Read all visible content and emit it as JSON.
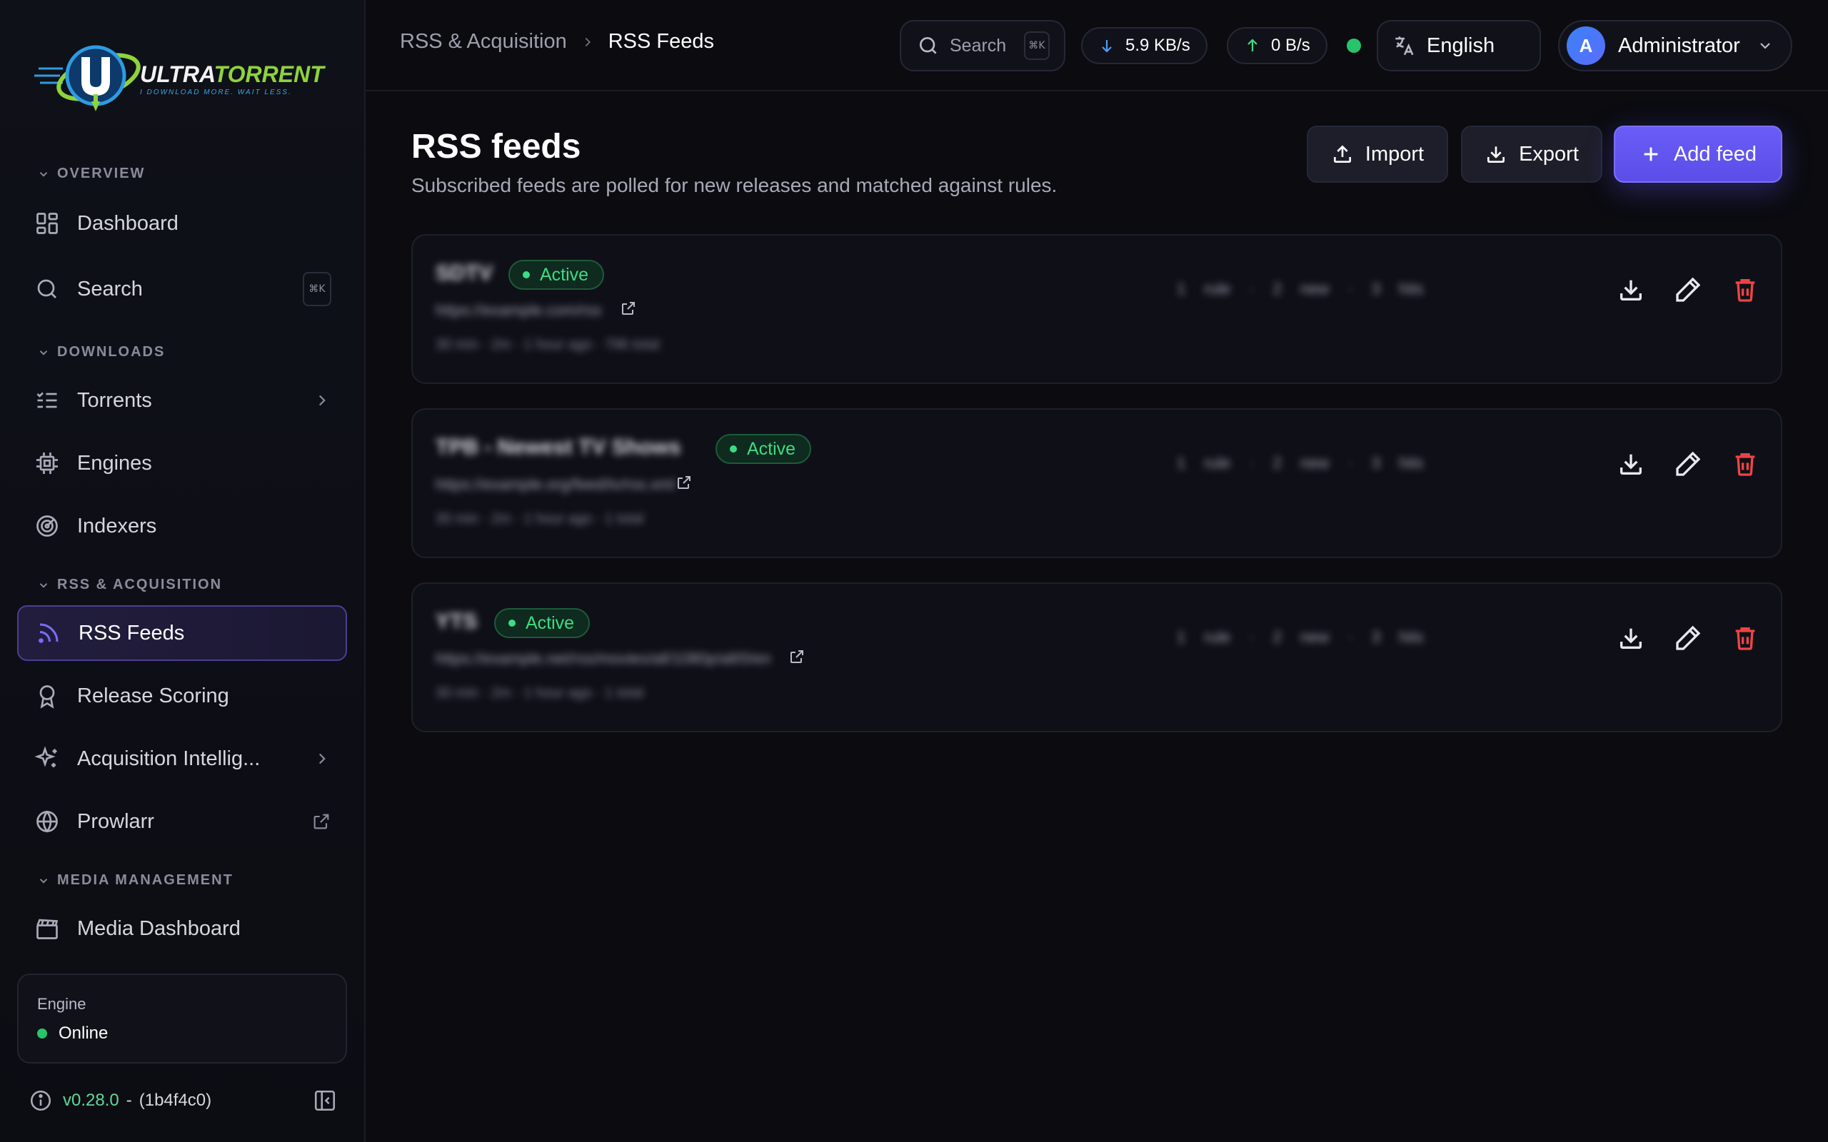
{
  "brand": {
    "name_part1": "ULTRA",
    "name_part2": "TORRENT",
    "tagline": "I DOWNLOAD MORE. WAIT LESS."
  },
  "sidebar": {
    "sections": {
      "overview": "OVERVIEW",
      "downloads": "DOWNLOADS",
      "rss": "RSS & ACQUISITION",
      "media": "MEDIA MANAGEMENT"
    },
    "items": {
      "dashboard": "Dashboard",
      "search": "Search",
      "search_shortcut": "⌘K",
      "torrents": "Torrents",
      "engines": "Engines",
      "indexers": "Indexers",
      "rss_feeds": "RSS Feeds",
      "release_scoring": "Release Scoring",
      "acquisition": "Acquisition Intellig...",
      "prowlarr": "Prowlarr",
      "media_dashboard": "Media Dashboard"
    },
    "engine": {
      "label": "Engine",
      "status": "Online"
    },
    "version": "v0.28.0",
    "version_sep": "-",
    "commit": "(1b4f4c0)"
  },
  "topbar": {
    "breadcrumb_parent": "RSS & Acquisition",
    "breadcrumb_current": "RSS Feeds",
    "search_placeholder": "Search",
    "search_shortcut": "⌘K",
    "download_speed": "5.9 KB/s",
    "upload_speed": "0 B/s",
    "language": "English",
    "user_initial": "A",
    "user_name": "Administrator"
  },
  "page": {
    "title": "RSS feeds",
    "subtitle": "Subscribed feeds are polled for new releases and matched against rules.",
    "import_label": "Import",
    "export_label": "Export",
    "add_label": "Add feed"
  },
  "feeds": [
    {
      "name": "SDTV",
      "status": "Active",
      "url": "https://example.com/rss",
      "meta": "30 min · 2m · 1 hour ago · 796 total",
      "stats": "1 rule · 2 new · 3 hits"
    },
    {
      "name": "TPB - Newest TV Shows",
      "status": "Active",
      "url": "https://example.org/feed/tv/rss.xml",
      "meta": "30 min · 2m · 1 hour ago · 1 total",
      "stats": "1 rule · 2 new · 3 hits"
    },
    {
      "name": "YTS",
      "status": "Active",
      "url": "https://example.net/rss/movies/all/1080p/all/0/en",
      "meta": "30 min · 2m · 1 hour ago · 1 total",
      "stats": "1 rule · 2 new · 3 hits"
    }
  ],
  "colors": {
    "accent": "#6a5cf7",
    "active_green": "#3ddc84",
    "danger": "#ef4444",
    "online": "#27c46b"
  }
}
